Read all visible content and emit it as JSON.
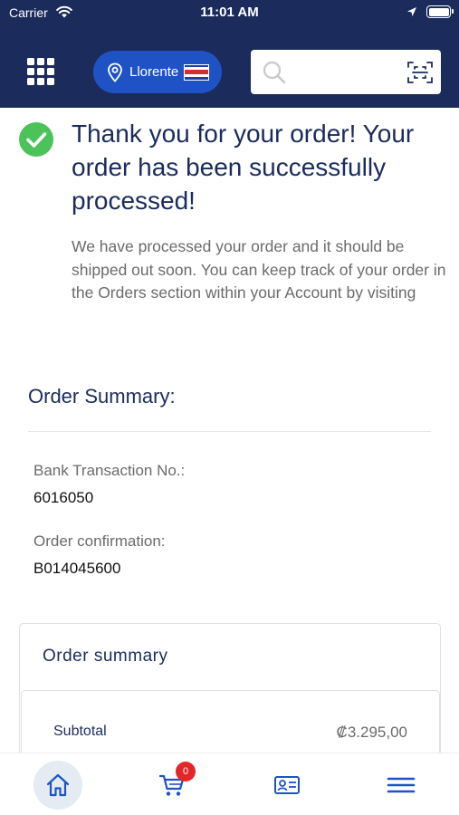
{
  "status_bar": {
    "carrier": "Carrier",
    "time": "11:01 AM"
  },
  "header": {
    "location": "Llorente",
    "search_placeholder": "",
    "icons": [
      "apps-grid-icon",
      "map-pin-icon",
      "costa-rica-flag-icon",
      "search-icon",
      "scan-icon"
    ]
  },
  "confirmation": {
    "title": "Thank you for your order! Your order has been successfully processed!",
    "description": "We have processed your order and it should be shipped out soon. You can keep track of your order in the Orders section within your Account by visiting"
  },
  "order_summary": {
    "heading": "Order Summary:",
    "bank_transaction_label": "Bank Transaction No.:",
    "bank_transaction_value": "6016050",
    "confirmation_label": "Order confirmation:",
    "confirmation_value": "B014045600"
  },
  "summary_card": {
    "title": "Order summary",
    "rows": [
      {
        "label": "Subtotal",
        "value": "₡3.295,00"
      }
    ]
  },
  "tabbar": {
    "cart_count": "0",
    "tabs": [
      "home-icon",
      "cart-icon",
      "card-icon",
      "menu-icon"
    ]
  },
  "colors": {
    "header_bg": "#1b2c5c",
    "accent_blue": "#1f53c5",
    "success_green": "#4cc25b",
    "badge_red": "#e3262a"
  }
}
